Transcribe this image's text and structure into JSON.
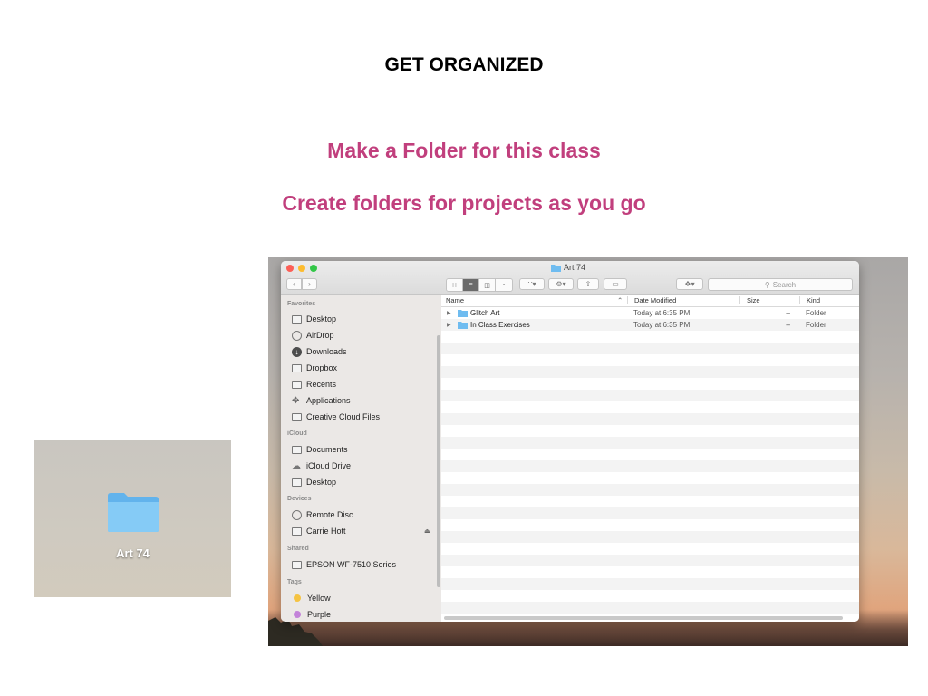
{
  "slide": {
    "title": "GET ORGANIZED",
    "subtitle1": "Make a Folder for this class",
    "subtitle2": "Create folders for projects as you go",
    "accent_color": "#c13f7d"
  },
  "desktop_folder": {
    "label": "Art 74",
    "icon": "folder-icon"
  },
  "finder": {
    "window_title": "Art 74",
    "search_placeholder": "Search",
    "sidebar": {
      "favorites_header": "Favorites",
      "favorites": [
        {
          "label": "Desktop",
          "icon": "desktop-icon"
        },
        {
          "label": "AirDrop",
          "icon": "airdrop-icon"
        },
        {
          "label": "Downloads",
          "icon": "downloads-icon"
        },
        {
          "label": "Dropbox",
          "icon": "folder-icon"
        },
        {
          "label": "Recents",
          "icon": "recents-icon"
        },
        {
          "label": "Applications",
          "icon": "applications-icon"
        },
        {
          "label": "Creative Cloud Files",
          "icon": "folder-icon"
        }
      ],
      "icloud_header": "iCloud",
      "icloud": [
        {
          "label": "Documents",
          "icon": "documents-icon"
        },
        {
          "label": "iCloud Drive",
          "icon": "cloud-icon"
        },
        {
          "label": "Desktop",
          "icon": "desktop-icon"
        }
      ],
      "devices_header": "Devices",
      "devices": [
        {
          "label": "Remote Disc",
          "icon": "disc-icon"
        },
        {
          "label": "Carrie Hott",
          "icon": "hard-drive-icon"
        }
      ],
      "shared_header": "Shared",
      "shared": [
        {
          "label": "EPSON WF-7510 Series",
          "icon": "display-icon"
        }
      ],
      "tags_header": "Tags",
      "tags": [
        {
          "label": "Yellow",
          "color": "#f5c342"
        },
        {
          "label": "Purple",
          "color": "#c383d9"
        }
      ]
    },
    "columns": {
      "name": "Name",
      "date": "Date Modified",
      "size": "Size",
      "kind": "Kind"
    },
    "files": [
      {
        "name": "Glitch Art",
        "date": "Today at 6:35 PM",
        "size": "--",
        "kind": "Folder"
      },
      {
        "name": "In Class Exercises",
        "date": "Today at 6:35 PM",
        "size": "--",
        "kind": "Folder"
      }
    ]
  }
}
